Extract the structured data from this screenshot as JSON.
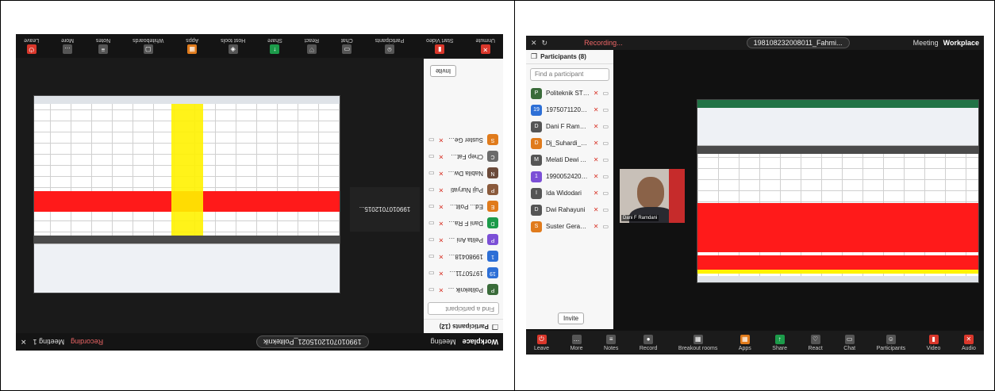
{
  "left": {
    "toolbar_labels": [
      "Unmute",
      "Start Video",
      "Participants",
      "Chat",
      "React",
      "Share",
      "Host tools",
      "Apps",
      "Whiteboards",
      "Notes",
      "More",
      "Leave"
    ],
    "participants_title": "Participants (12)",
    "search_placeholder": "Find a participant",
    "participants": [
      {
        "name": "Politeknik STIA LAN B... (Host, me)",
        "initial": "P",
        "color": "#3a6b3a"
      },
      {
        "name": "197507112006011... (Co-host)",
        "initial": "19",
        "color": "#2d6fd6"
      },
      {
        "name": "199804182019021_Aldo_Dwi...",
        "initial": "1",
        "color": "#2d6fd6"
      },
      {
        "name": "Pelita Ani P. Kurnia",
        "initial": "P",
        "color": "#7b4fd6"
      },
      {
        "name": "Dani F Ramdani",
        "initial": "D",
        "color": "#1c9b4a"
      },
      {
        "name": "Ed... Politeknik STIA LAN B...",
        "initial": "E",
        "color": "#e07b1c"
      },
      {
        "name": "Puji Nuryati",
        "initial": "P",
        "color": "#8a5a3c"
      },
      {
        "name": "Nabila Dwivi Ayu",
        "initial": "N",
        "color": "#6b4a3a"
      },
      {
        "name": "Chep Fatmawati",
        "initial": "C",
        "color": "#6b6b6b"
      },
      {
        "name": "Suster Gerakan Pahdi Asih",
        "initial": "S",
        "color": "#e07b1c"
      }
    ],
    "invite_label": "Invite",
    "meeting_id_label": "1990107012015...",
    "taskbar": [
      "Workplace",
      "Meeting",
      "1990107012015021_Politeknik",
      "Recording",
      "Meeting 1"
    ]
  },
  "right": {
    "app_name": "Workplace",
    "topbar_meeting": "Meeting",
    "meeting_title": "198108232008011_Fahmi...",
    "recording": "Recording...",
    "participants_title": "Participants (8)",
    "search_placeholder": "Find a participant",
    "participants": [
      {
        "name": "Politeknik STIA LAN B... (Host, me)",
        "initial": "P",
        "color": "#3a6b3a"
      },
      {
        "name": "197507112006011... (Co-host)",
        "initial": "19",
        "color": "#2d6fd6"
      },
      {
        "name": "Dani F Ramdani",
        "initial": "D",
        "color": "#555"
      },
      {
        "name": "Dj_Suhardi_Politik STIA LAN Ban...",
        "initial": "D",
        "color": "#e07b1c"
      },
      {
        "name": "Melati Dewi Asri",
        "initial": "M",
        "color": "#555"
      },
      {
        "name": "199005242019021_Anggi Sya...",
        "initial": "1",
        "color": "#7b4fd6"
      },
      {
        "name": "Ida Widodari",
        "initial": "I",
        "color": "#555"
      },
      {
        "name": "Dwi Rahayuni",
        "initial": "D",
        "color": "#555"
      },
      {
        "name": "Suster Gerakan Pahdi Asih",
        "initial": "S",
        "color": "#e07b1c"
      }
    ],
    "invite_label": "Invite",
    "video_name": "Dani F Ramdani",
    "bottom_labels": [
      "Audio",
      "Video",
      "Participants",
      "Chat",
      "React",
      "Share",
      "Apps",
      "Breakout rooms",
      "Record",
      "Notes",
      "More",
      "Leave"
    ]
  }
}
